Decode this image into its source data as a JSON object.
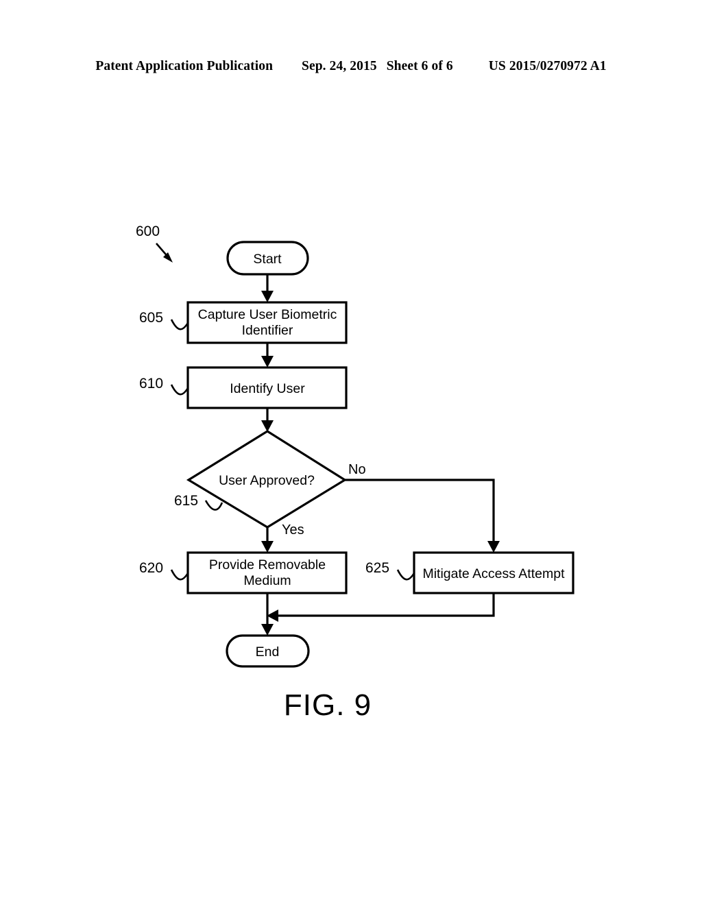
{
  "header": {
    "publication": "Patent Application Publication",
    "date": "Sep. 24, 2015",
    "sheet": "Sheet 6 of 6",
    "patent_number": "US 2015/0270972 A1"
  },
  "figure": {
    "caption": "FIG. 9",
    "diagram_ref": "600",
    "nodes": {
      "start": {
        "label": "Start",
        "ref": ""
      },
      "capture": {
        "label_line1": "Capture User Biometric",
        "label_line2": "Identifier",
        "ref": "605"
      },
      "identify": {
        "label": "Identify User",
        "ref": "610"
      },
      "decision": {
        "label": "User Approved?",
        "ref": "615"
      },
      "provide": {
        "label_line1": "Provide Removable",
        "label_line2": "Medium",
        "ref": "620"
      },
      "mitigate": {
        "label": "Mitigate Access Attempt",
        "ref": "625"
      },
      "end": {
        "label": "End",
        "ref": ""
      }
    },
    "branches": {
      "yes": "Yes",
      "no": "No"
    }
  }
}
